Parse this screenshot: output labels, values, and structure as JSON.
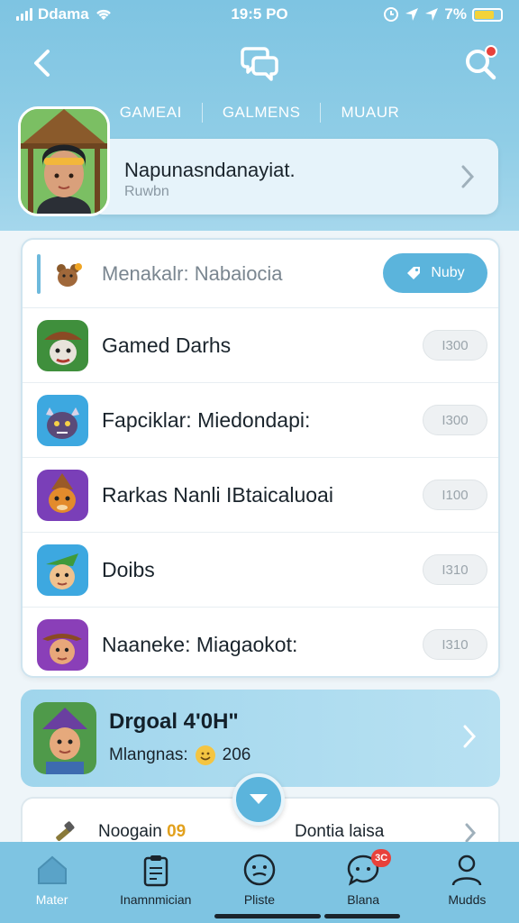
{
  "status_bar": {
    "carrier": "Ddama",
    "time": "19:5 PO",
    "battery_percent": "7%",
    "battery_level": 0.75
  },
  "nav": {
    "back_icon": "chevron-left-icon",
    "center_icon": "chat-bubbles-icon",
    "search_icon": "search-icon"
  },
  "tabs": [
    "GAMEAI",
    "GALMENS",
    "MUAUR"
  ],
  "profile": {
    "name": "Napunasndanayiat.",
    "subtitle": "Ruwbn"
  },
  "list": {
    "header_title": "Menakalr: Nabaiocia",
    "header_button": "Nuby",
    "items": [
      {
        "title": "Gamed Darhs",
        "value": "I300"
      },
      {
        "title": "Fapciklar: Miedondapi:",
        "value": "I300"
      },
      {
        "title": "Rarkas Nanli IBtaicaluoai",
        "value": "I100"
      },
      {
        "title": "Doibs",
        "value": "I310"
      },
      {
        "title": "Naaneke: Miagaokot:",
        "value": "I310"
      }
    ]
  },
  "featured": {
    "title": "Drgoal 4'0H\"",
    "subtitle_label": "Mlangnas:",
    "subtitle_value": "206"
  },
  "bottom_card": {
    "left_label": "Noogain",
    "left_accent": "09",
    "right_label": "Dontia laisa"
  },
  "tabbar": [
    {
      "label": "Mater",
      "icon": "home-icon",
      "active": true
    },
    {
      "label": "Inamnmician",
      "icon": "clipboard-icon"
    },
    {
      "label": "Pliste",
      "icon": "emoji-face-icon"
    },
    {
      "label": "Blana",
      "icon": "chat-icon",
      "badge": "3C"
    },
    {
      "label": "Mudds",
      "icon": "profile-icon"
    }
  ],
  "colors": {
    "header": "#7ec4e2",
    "accent": "#5bb4dc",
    "badge": "#e8413b"
  }
}
